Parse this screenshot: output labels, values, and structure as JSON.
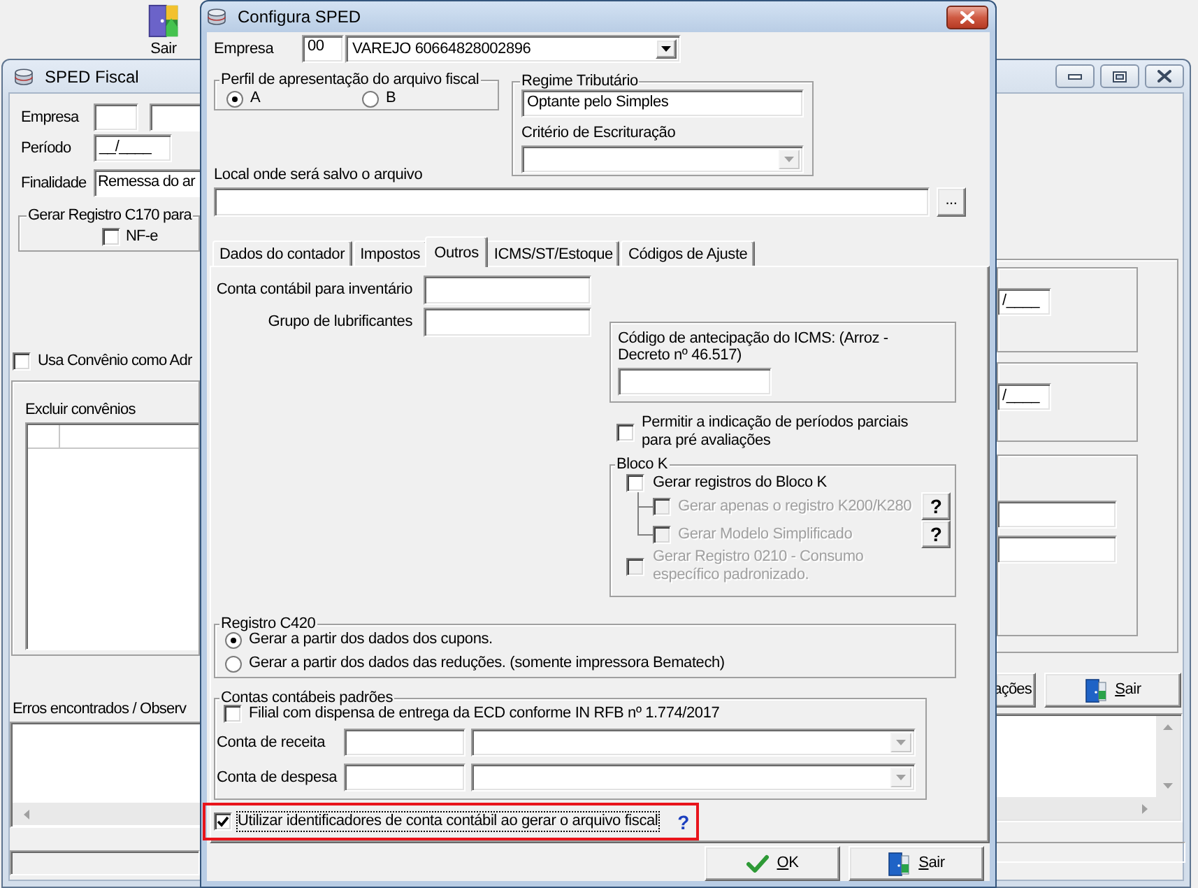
{
  "toolbar": {
    "buttons": [
      {
        "label": "Sair",
        "kind": "exit"
      }
    ]
  },
  "main_window": {
    "title": "SPED Fiscal",
    "left_panel": {
      "empresa_label": "Empresa",
      "periodo": {
        "label": "Período",
        "value": "__/____"
      },
      "finalidade": {
        "label": "Finalidade",
        "value": "Remessa do ar"
      },
      "c170_group": {
        "title": "Gerar Registro C170 para",
        "options": [
          {
            "label": "NF-e",
            "checked": false
          }
        ]
      },
      "convenio": {
        "label": "Usa Convênio como Adr",
        "checked": false
      },
      "excluir_label": "Excluir convênios",
      "erros_label": "Erros encontrados / Observ"
    },
    "right_panel": {
      "period_fields": [
        {
          "value": "/____"
        },
        {
          "value": "/____"
        }
      ],
      "buttons": [
        {
          "label": "ações",
          "kind": "text"
        },
        {
          "label": "Sair",
          "kind": "exit"
        }
      ]
    }
  },
  "dialog": {
    "title": "Configura SPED",
    "empresa": {
      "label": "Empresa",
      "code": "00",
      "value": "VAREJO 60664828002896",
      "disabled": false
    },
    "perfil": {
      "title": "Perfil de apresentação do arquivo fiscal",
      "options": [
        {
          "label": "A",
          "selected": true
        },
        {
          "label": "B",
          "selected": false
        }
      ]
    },
    "regime": {
      "title": "Regime Tributário",
      "value": "Optante pelo Simples",
      "criterio": {
        "label": "Critério de Escrituração",
        "disabled": true
      }
    },
    "local": {
      "label": "Local onde será salvo o arquivo",
      "browse": "..."
    },
    "tabs": [
      {
        "label": "Dados do contador",
        "selected": false
      },
      {
        "label": "Impostos",
        "selected": false
      },
      {
        "label": "Outros",
        "selected": true
      },
      {
        "label": "ICMS/ST/Estoque",
        "selected": false
      },
      {
        "label": "Códigos de Ajuste",
        "selected": false
      }
    ],
    "outros": {
      "fields": [
        {
          "label": "Conta contábil para inventário"
        },
        {
          "label": "Grupo de lubrificantes"
        }
      ],
      "antecipacao": {
        "label": "Código de antecipação do ICMS: (Arroz - Decreto nº 46.517)"
      },
      "periodos_parciais": {
        "label": "Permitir a indicação de períodos parciais para pré avaliações",
        "checked": false
      },
      "bloco_k": {
        "title": "Bloco K",
        "options": [
          {
            "label": "Gerar registros do Bloco K",
            "checked": false,
            "disabled": false,
            "children": [
              {
                "label": "Gerar apenas o registro K200/K280",
                "checked": false,
                "disabled": true,
                "help": "?"
              },
              {
                "label": "Gerar Modelo Simplificado",
                "checked": false,
                "disabled": true,
                "help": "?"
              }
            ]
          },
          {
            "label": "Gerar Registro 0210 - Consumo específico padronizado.",
            "checked": false,
            "disabled": true
          }
        ]
      },
      "c420": {
        "title": "Registro C420",
        "options": [
          {
            "label": "Gerar a partir dos dados dos cupons.",
            "selected": true
          },
          {
            "label": "Gerar a partir dos dados das reduções. (somente impressora Bematech)",
            "selected": false
          }
        ]
      },
      "contas": {
        "title": "Contas contábeis padrões",
        "dispensa": {
          "label": "Filial com dispensa de entrega da ECD conforme IN RFB nº 1.774/2017",
          "checked": false
        },
        "accounts": [
          {
            "label": "Conta de receita",
            "disabled": true
          },
          {
            "label": "Conta de despesa",
            "disabled": true
          }
        ]
      },
      "identificadores": {
        "label": "Utilizar identificadores de conta contábil ao gerar o arquivo fiscal",
        "checked": true,
        "focused": true,
        "highlighted": true,
        "help": "?"
      }
    },
    "buttons": [
      {
        "label": "OK",
        "kind": "ok"
      },
      {
        "label": "Sair",
        "kind": "exit"
      }
    ]
  }
}
